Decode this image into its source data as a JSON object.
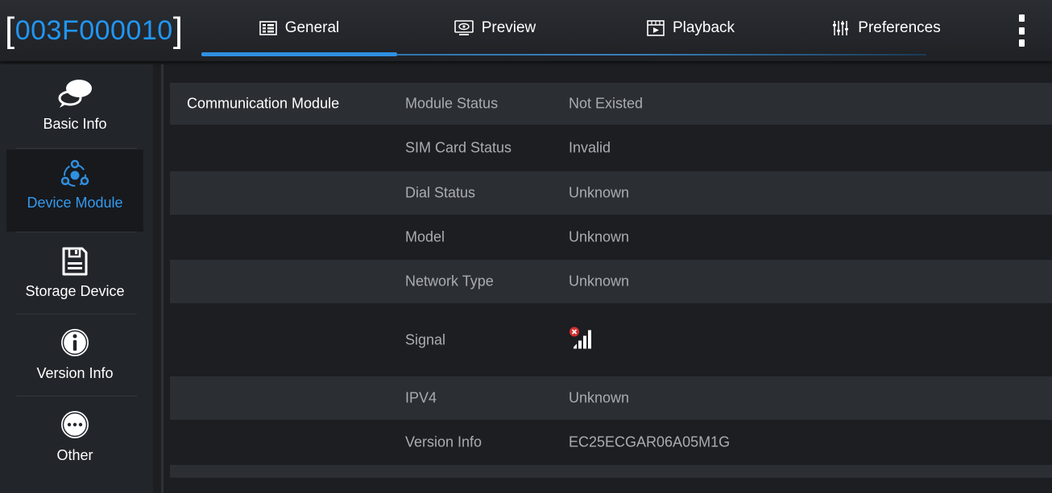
{
  "header": {
    "device_id": "003F000010",
    "tabs": [
      {
        "label": "General",
        "icon": "general-icon"
      },
      {
        "label": "Preview",
        "icon": "preview-monitor-icon"
      },
      {
        "label": "Playback",
        "icon": "playback-film-icon"
      },
      {
        "label": "Preferences",
        "icon": "preferences-sliders-icon"
      }
    ],
    "active_tab": "General",
    "menu_icon": "more-vertical-icon"
  },
  "sidebar": {
    "items": [
      {
        "label": "Basic Info",
        "icon": "chat-bubble-icon"
      },
      {
        "label": "Device Module",
        "icon": "device-module-icon"
      },
      {
        "label": "Storage Device",
        "icon": "floppy-disk-icon"
      },
      {
        "label": "Version Info",
        "icon": "info-circle-icon"
      },
      {
        "label": "Other",
        "icon": "more-circle-icon"
      }
    ],
    "active_item": "Device Module"
  },
  "content": {
    "section_title": "Communication Module",
    "rows": [
      {
        "key": "Module Status",
        "value": "Not Existed"
      },
      {
        "key": "SIM Card Status",
        "value": "Invalid"
      },
      {
        "key": "Dial Status",
        "value": "Unknown"
      },
      {
        "key": "Model",
        "value": "Unknown"
      },
      {
        "key": "Network Type",
        "value": "Unknown"
      },
      {
        "key": "Signal",
        "value": "",
        "icon": "signal-no-service-icon"
      },
      {
        "key": "IPV4",
        "value": "Unknown"
      },
      {
        "key": "Version Info",
        "value": "EC25ECGAR06A05M1G"
      }
    ]
  },
  "colors": {
    "accent": "#2196f3",
    "background": "#1c1e22",
    "row_alt": "#2b2e33",
    "error": "#d32f2f"
  }
}
